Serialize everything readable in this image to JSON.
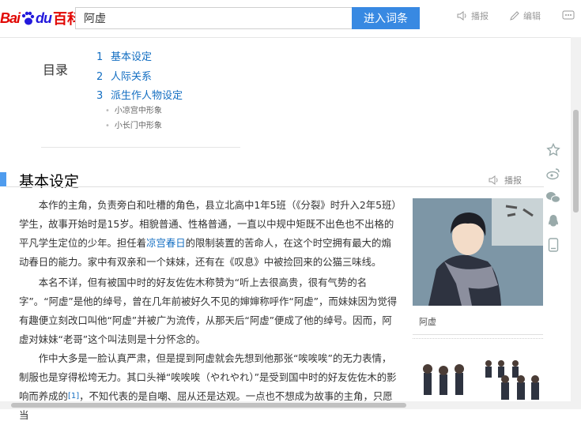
{
  "header": {
    "logo_bai": "Bai",
    "logo_du": "du",
    "logo_baike": "百科",
    "search_value": "阿虚",
    "search_button": "进入词条",
    "action_listen": "播报",
    "action_edit": "编辑"
  },
  "toc": {
    "title": "目录",
    "items": [
      {
        "num": "1",
        "label": "基本设定"
      },
      {
        "num": "2",
        "label": "人际关系"
      },
      {
        "num": "3",
        "label": "派生作人物设定"
      }
    ],
    "subitems": [
      "小凉宫中形象",
      "小长门中形象"
    ]
  },
  "section": {
    "title": "基本设定",
    "listen": "播报"
  },
  "paragraphs": {
    "p1_a": "本作的主角，负责旁白和吐槽的角色，县立北高中1年5班（《分裂》时升入2年5班）学生，故事开始时是15岁。相貌普通、性格普通，一直以中规中矩既不出色也不出格的平凡学生定位的少年。担任着",
    "p1_link": "凉宫春日",
    "p1_b": "的限制装置的苦命人，在这个时空拥有最大的煽动春日的能力。家中有双亲和一个妹妹，还有在《叹息》中被捡回来的公猫三味线。",
    "p2": "本名不详，但有被国中时的好友佐佐木称赞为“听上去很高贵，很有气势的名字”。“阿虚”是他的绰号，曾在几年前被好久不见的婶婶称呼作“阿虚”，而妹妹因为觉得有趣便立刻改口叫他“阿虚”并被广为流传，从那天后“阿虚”便成了他的绰号。因而，阿虚对妹妹“老哥”这个叫法则是十分怀念的。",
    "p3_a": "作中大多是一脸认真严肃，但是提到阿虚就会先想到他那张“唉唉唉”的无力表情，制服也是穿得松垮无力。其口头禅“唉唉唉（やれやれ）”是受到国中时的好友佐佐木的影响而养成的",
    "p3_sup": "[1]",
    "p3_b": "，不知代表的是自嘲、屈从还是达观。一点也不想成为故事的主角，只愿当"
  },
  "image": {
    "caption": "阿虚"
  },
  "colors": {
    "link": "#136ec2",
    "button": "#3889e2",
    "section_bar": "#4f9cee",
    "logo_red": "#e10602",
    "logo_blue": "#2319dc"
  }
}
